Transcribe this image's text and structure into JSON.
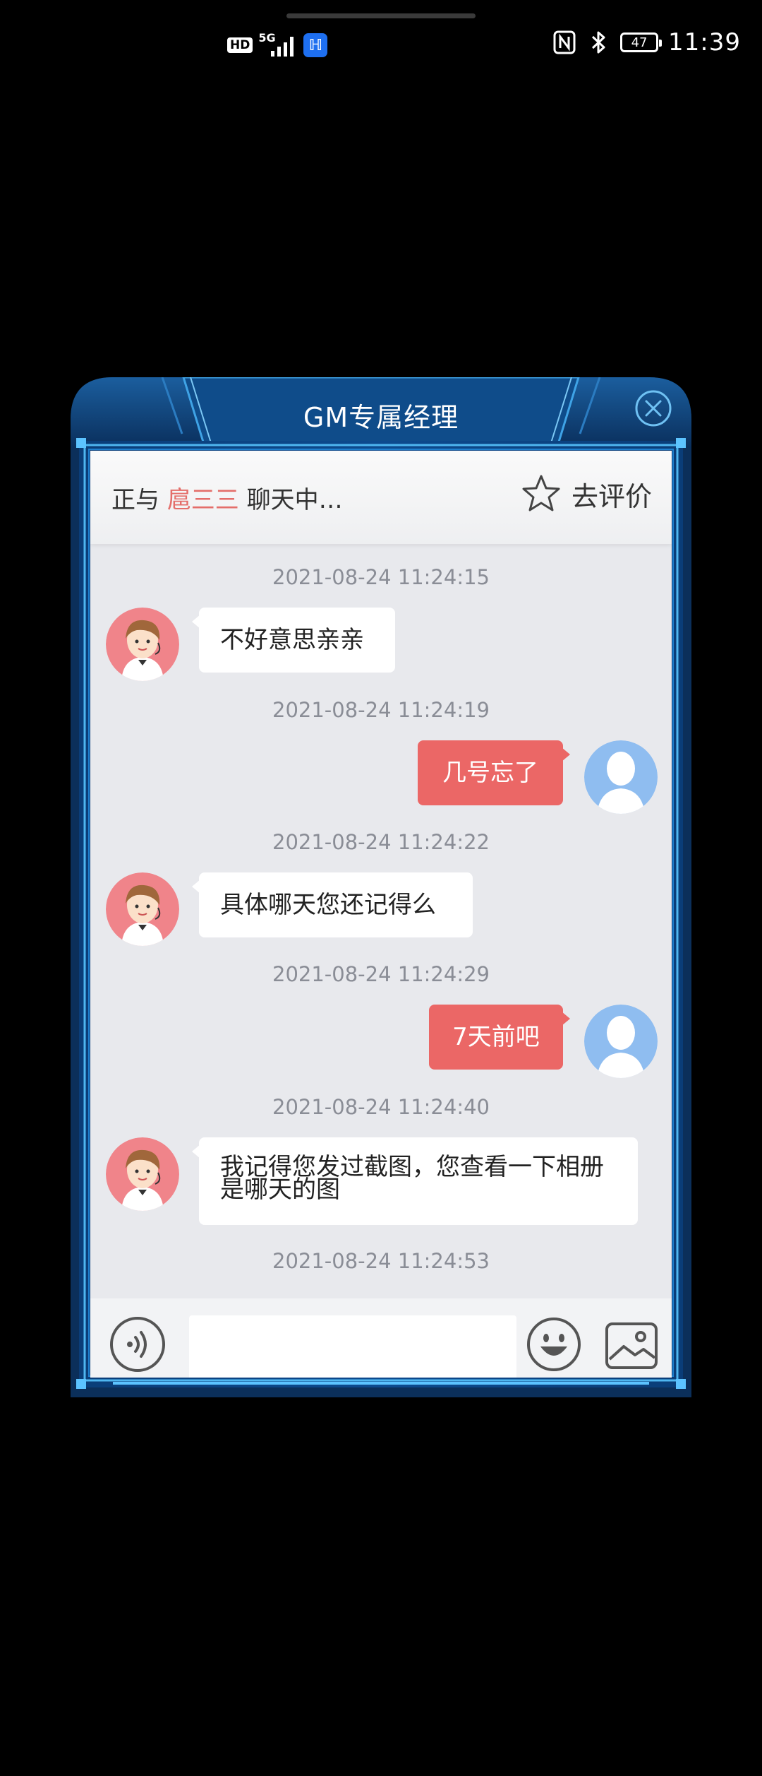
{
  "status_bar": {
    "hd_badge": "HD",
    "network": "5G",
    "battery_level": "47",
    "time": "11:39"
  },
  "dialog": {
    "title": "GM专属经理",
    "chat_status": {
      "prefix": "正与",
      "agent_name": "扈三三",
      "suffix": "聊天中…"
    },
    "rate_label": "去评价",
    "messages": [
      {
        "time": "2021-08-24 11:24:15",
        "side": "agent",
        "text": "不好意思亲亲"
      },
      {
        "time": "2021-08-24 11:24:19",
        "side": "user",
        "text": "几号忘了"
      },
      {
        "time": "2021-08-24 11:24:22",
        "side": "agent",
        "text": "具体哪天您还记得么"
      },
      {
        "time": "2021-08-24 11:24:29",
        "side": "user",
        "text": "7天前吧"
      },
      {
        "time": "2021-08-24 11:24:40",
        "side": "agent",
        "text": "我记得您发过截图，您查看一下相册是哪天的图"
      },
      {
        "time": "2021-08-24 11:24:53",
        "side": "",
        "text": ""
      }
    ],
    "input": {
      "value": "",
      "placeholder": ""
    }
  },
  "colors": {
    "user_bubble": "#eb6766",
    "agent_bubble": "#ffffff",
    "agent_name": "#e46e6a",
    "frame_blue": "#0b4a8c"
  }
}
